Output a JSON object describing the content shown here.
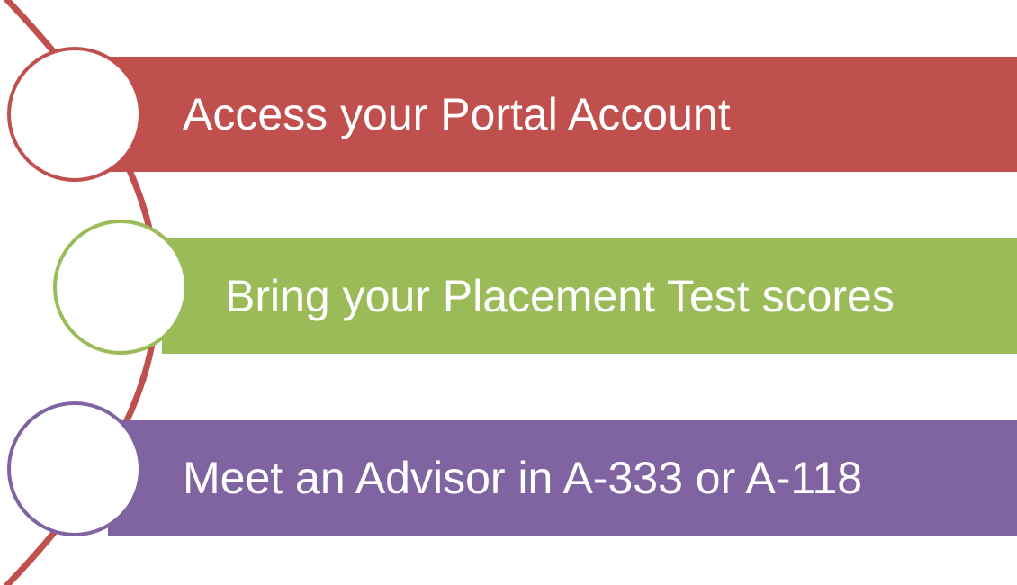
{
  "steps": [
    {
      "label": "Access your Portal Account",
      "color": "#C0504D"
    },
    {
      "label": "Bring your Placement Test scores",
      "color": "#9BBB59"
    },
    {
      "label": "Meet an Advisor in A-333 or A-118",
      "color": "#8064A2"
    }
  ],
  "connector_color": "#C0504D"
}
